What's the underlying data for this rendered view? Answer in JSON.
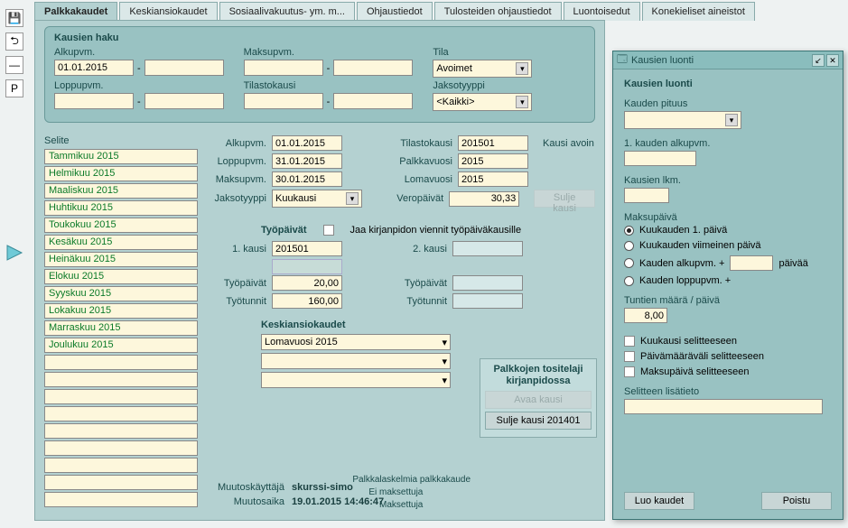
{
  "tabs": [
    "Palkkakaudet",
    "Keskiansiokaudet",
    "Sosiaalivakuutus- ym. m...",
    "Ohjaustiedot",
    "Tulosteiden ohjaustiedot",
    "Luontoisedut",
    "Konekieliset aineistot"
  ],
  "toolbar": {
    "p_label": "P"
  },
  "search": {
    "title": "Kausien haku",
    "alku_label": "Alkupvm.",
    "alku_from": "01.01.2015",
    "alku_to": "",
    "loppu_label": "Loppupvm.",
    "loppu_from": "",
    "loppu_to": "",
    "maksu_label": "Maksupvm.",
    "maksu_from": "",
    "maksu_to": "",
    "tilasto_label": "Tilastokausi",
    "tilasto_from": "",
    "tilasto_to": "",
    "tila_label": "Tila",
    "tila_value": "Avoimet",
    "jakso_label": "Jaksotyyppi",
    "jakso_value": "<Kaikki>"
  },
  "selite": {
    "label": "Selite",
    "items": [
      "Tammikuu 2015",
      "Helmikuu 2015",
      "Maaliskuu 2015",
      "Huhtikuu 2015",
      "Toukokuu 2015",
      "Kesäkuu 2015",
      "Heinäkuu 2015",
      "Elokuu 2015",
      "Syyskuu 2015",
      "Lokakuu 2015",
      "Marraskuu 2015",
      "Joulukuu 2015",
      "",
      "",
      "",
      "",
      "",
      "",
      "",
      "",
      ""
    ]
  },
  "detail": {
    "alku_label": "Alkupvm.",
    "alku": "01.01.2015",
    "loppu_label": "Loppupvm.",
    "loppu": "31.01.2015",
    "maksu_label": "Maksupvm.",
    "maksu": "30.01.2015",
    "jakso_label": "Jaksotyyppi",
    "jakso": "Kuukausi",
    "tilasto_label": "Tilastokausi",
    "tilasto": "201501",
    "palkka_label": "Palkkavuosi",
    "palkka": "2015",
    "loma_label": "Lomavuosi",
    "loma": "2015",
    "vero_label": "Veropäivät",
    "vero": "30,33",
    "status": "Kausi avoin",
    "sulje_btn": "Sulje kausi"
  },
  "tyopaivat": {
    "heading": "Työpäivät",
    "jaa_label": "Jaa kirjanpidon viennit työpäiväkausille",
    "kausi1_label": "1. kausi",
    "kausi1": "201501",
    "kausi2_label": "2. kausi",
    "kausi2": "",
    "tp_label": "Työpäivät",
    "tp1": "20,00",
    "tp2": "",
    "tt_label": "Työtunnit",
    "tt1": "160,00",
    "tt2": ""
  },
  "keskiansio": {
    "heading": "Keskiansiokaudet",
    "items": [
      "Lomavuosi 2015",
      "",
      ""
    ]
  },
  "tosite": {
    "title": "Palkkojen tositelaji kirjanpidossa",
    "avaa": "Avaa kausi",
    "sulje": "Sulje kausi 201401"
  },
  "lask": {
    "header": "Palkkalaskelmia palkkakaude",
    "ei_label": "Ei maksettuja",
    "mak_label": "Maksettuja"
  },
  "footer": {
    "muutos_label": "Muutoskäyttäjä",
    "muutos_user": "skurssi-simo",
    "aika_label": "Muutosaika",
    "aika": "19.01.2015 14:46:47"
  },
  "modal": {
    "window_title": "Kausien luonti",
    "heading": "Kausien luonti",
    "pituus_label": "Kauden pituus",
    "pituus": "",
    "alku_label": "1. kauden alkupvm.",
    "alku": "",
    "lkm_label": "Kausien lkm.",
    "lkm": "",
    "maksu_heading": "Maksupäivä",
    "opts": [
      "Kuukauden 1. päivä",
      "Kuukauden viimeinen päivä",
      "Kauden alkupvm. +",
      "Kauden loppupvm. +"
    ],
    "paivaa_label": "päivää",
    "tuntia_label": "Tuntien määrä / päivä",
    "tuntia": "8,00",
    "cb": [
      "Kuukausi selitteeseen",
      "Päivämääräväli selitteeseen",
      "Maksupäivä selitteeseen"
    ],
    "lisatieto_label": "Selitteen lisätieto",
    "luo_btn": "Luo kaudet",
    "poistu_btn": "Poistu"
  }
}
